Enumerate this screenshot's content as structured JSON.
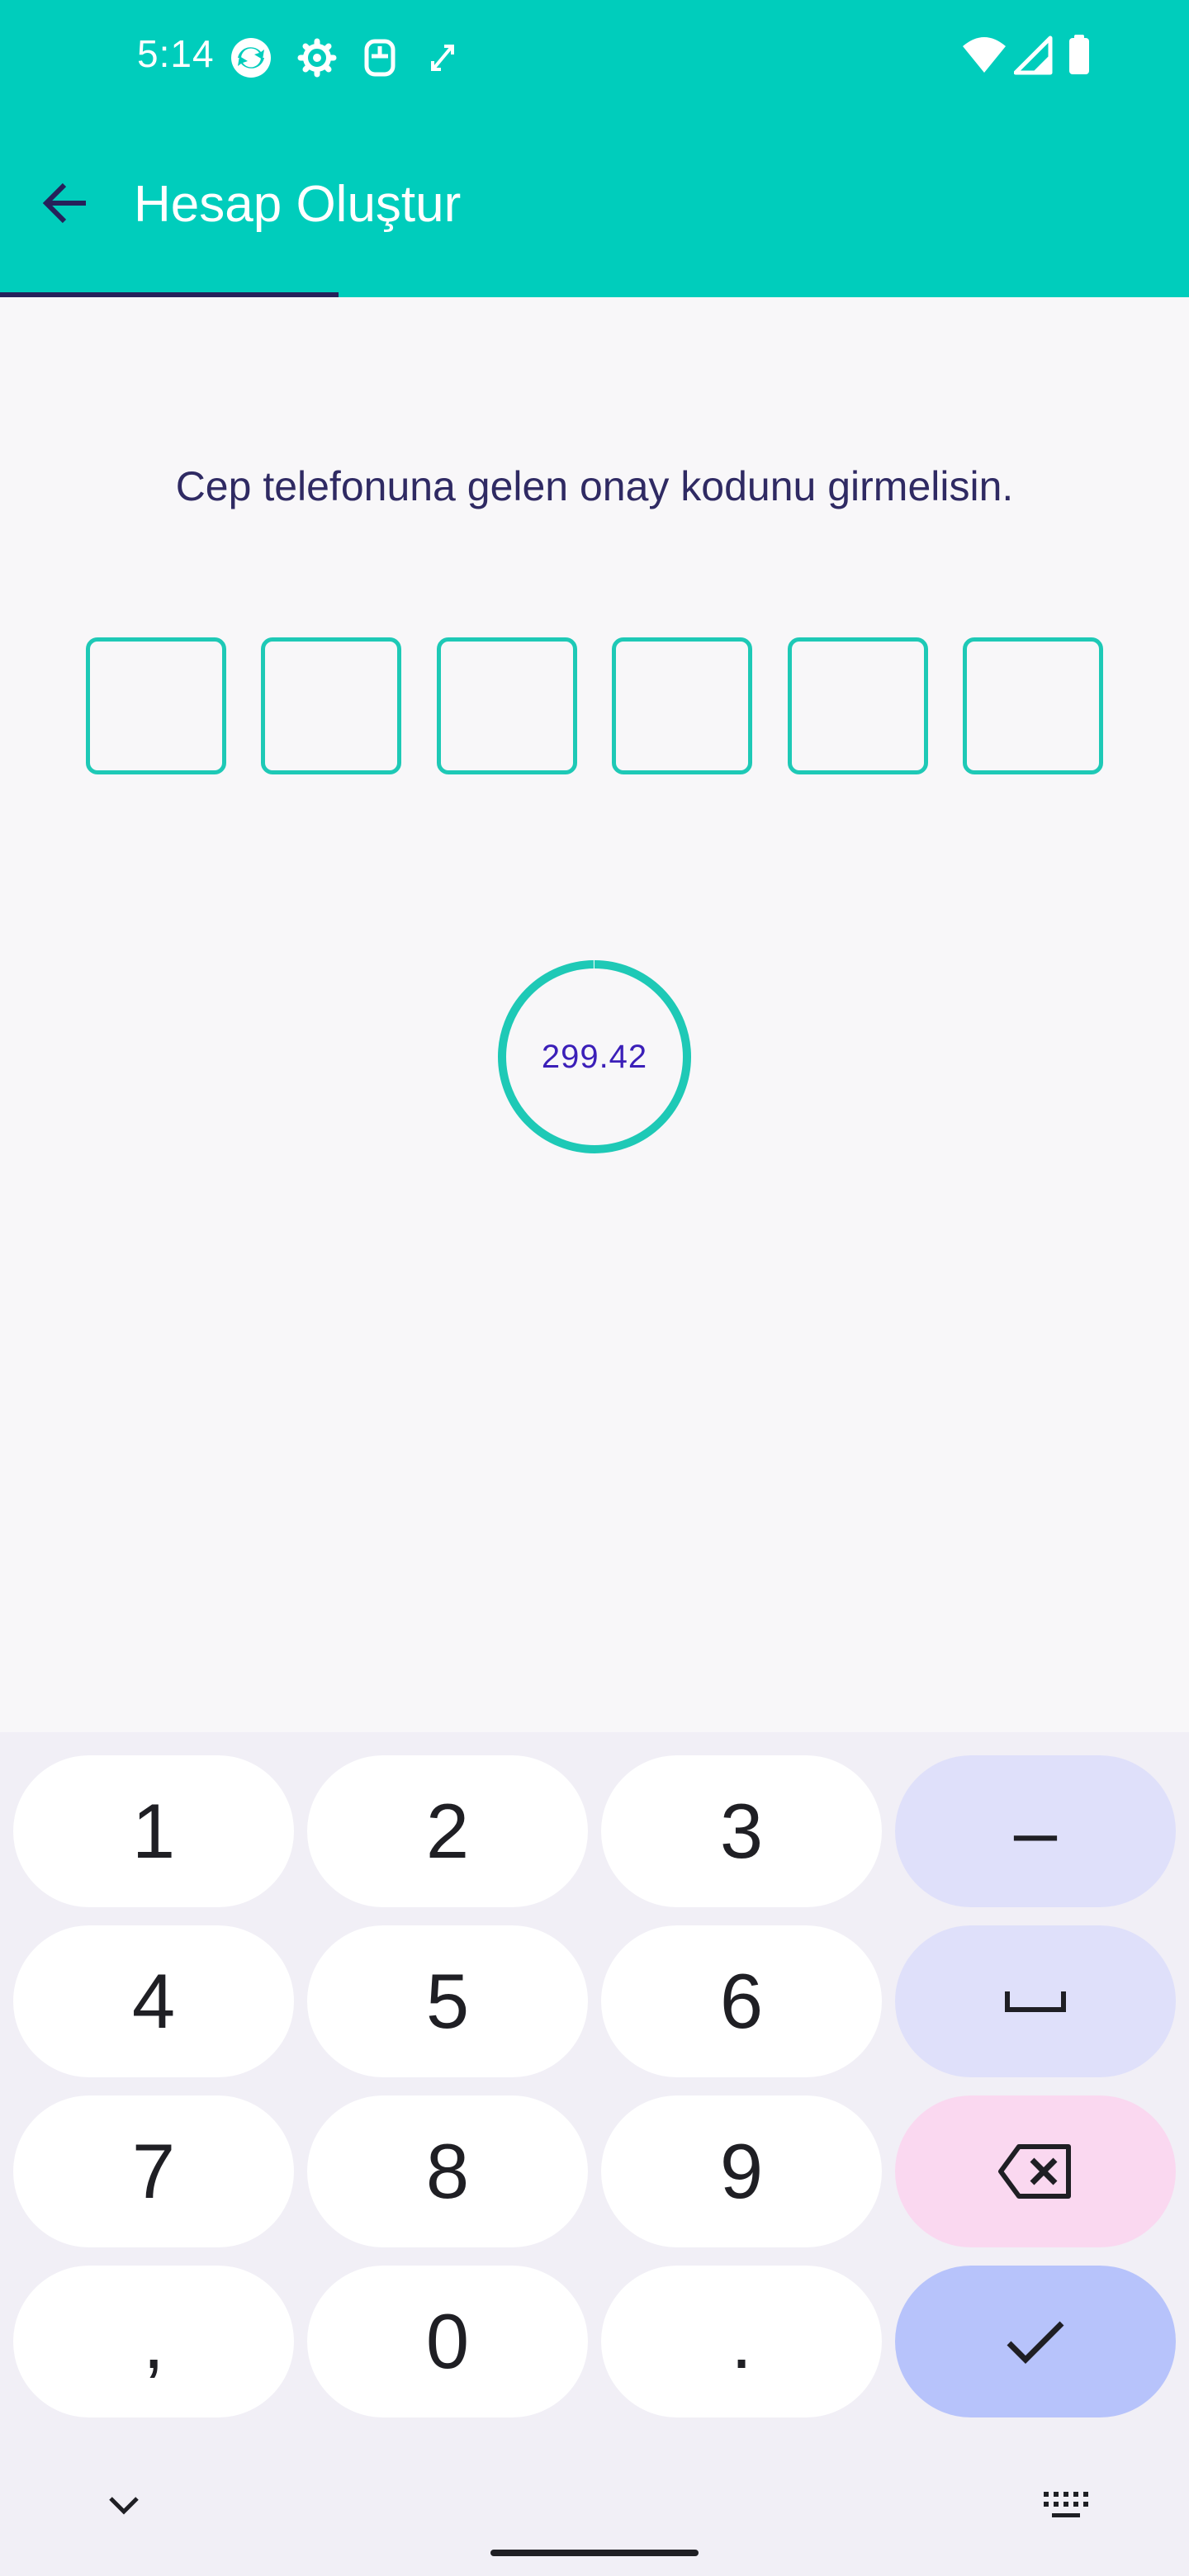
{
  "status_bar": {
    "time": "5:14",
    "left_icons": [
      "sync-icon",
      "gear-icon",
      "sim-icon",
      "expand-arrows-icon"
    ],
    "right_icons": [
      "wifi-icon",
      "signal-icon",
      "battery-icon"
    ]
  },
  "app_bar": {
    "title": "Hesap Oluştur",
    "back_icon": "arrow-left-icon",
    "progress_fraction": 0.285
  },
  "verification": {
    "instruction": "Cep telefonuna gelen onay kodunu girmelisin.",
    "code_length": 6,
    "code_values": [
      "",
      "",
      "",
      "",
      "",
      ""
    ]
  },
  "timer": {
    "value": "299.42",
    "progress_fraction": 0.998
  },
  "keyboard": {
    "rows": [
      [
        "1",
        "2",
        "3",
        "–"
      ],
      [
        "4",
        "5",
        "6",
        "␣"
      ],
      [
        "7",
        "8",
        "9",
        "⌫"
      ],
      [
        ",",
        "0",
        ".",
        "✓"
      ]
    ]
  },
  "colors": {
    "primary": "#00cdbc",
    "accent_dark": "#26215a",
    "text": "#2f2a63",
    "timer_text": "#3b1fb8"
  }
}
